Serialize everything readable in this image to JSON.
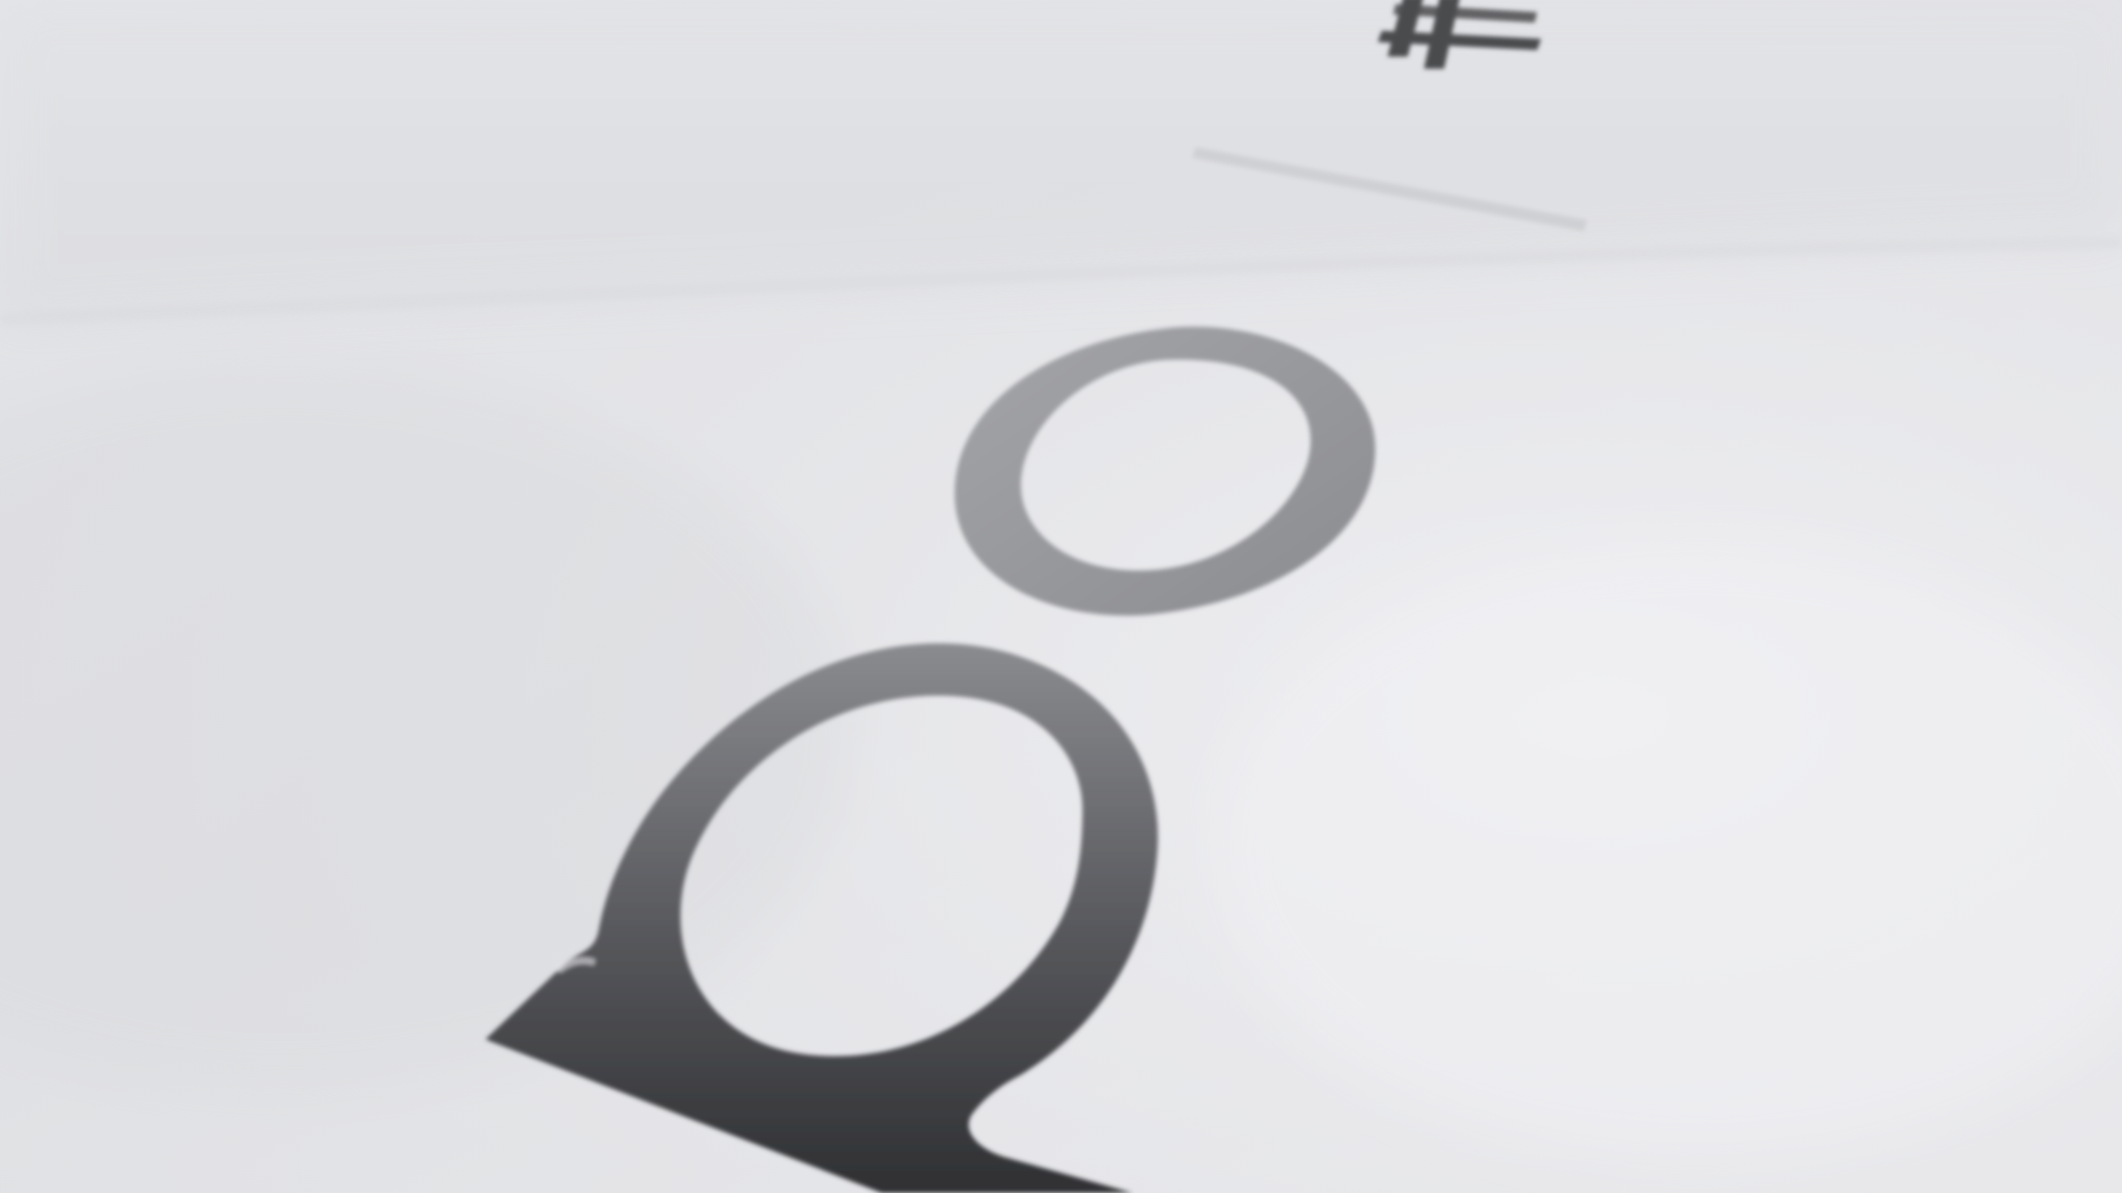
{
  "image": {
    "kind": "close-up photo of printed logotype on a white surface",
    "visible_text": "",
    "colors": {
      "background_light": "#ededf0",
      "background_shadow": "#dcdde1",
      "fold_band": "#e4e5e8",
      "ring_small": "#9b9c9f",
      "glyph_large_top": "#7b7c80",
      "glyph_large_bottom": "#323336",
      "rule_line": "#cfd0d3",
      "mark_top": "#4a4b4e"
    },
    "icons": {
      "small_ring": "ring-icon",
      "large_glyph": "p-glyph-icon",
      "top_mark": "cross-mark-icon",
      "rule": "divider-line"
    }
  }
}
